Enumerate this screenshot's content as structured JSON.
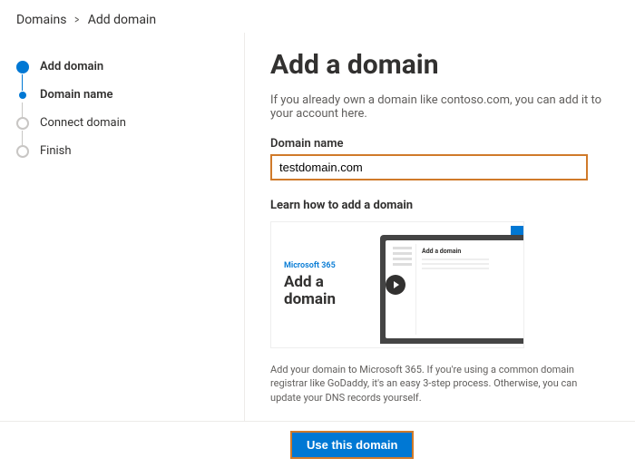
{
  "breadcrumb": {
    "root": "Domains",
    "current": "Add domain"
  },
  "steps": [
    {
      "label": "Add domain"
    },
    {
      "label": "Domain name"
    },
    {
      "label": "Connect domain"
    },
    {
      "label": "Finish"
    }
  ],
  "main": {
    "heading": "Add a domain",
    "intro": "If you already own a domain like contoso.com, you can add it to your account here.",
    "field_label": "Domain name",
    "domain_value": "testdomain.com",
    "learn_header": "Learn how to add a domain",
    "video": {
      "brand": "Microsoft 365",
      "title": "Add a domain",
      "mini_title": "Add a domain"
    },
    "help_text": "Add your domain to Microsoft 365. If you're using a common domain registrar like GoDaddy, it's an easy 3-step process. Otherwise, you can update your DNS records yourself."
  },
  "footer": {
    "primary": "Use this domain"
  }
}
